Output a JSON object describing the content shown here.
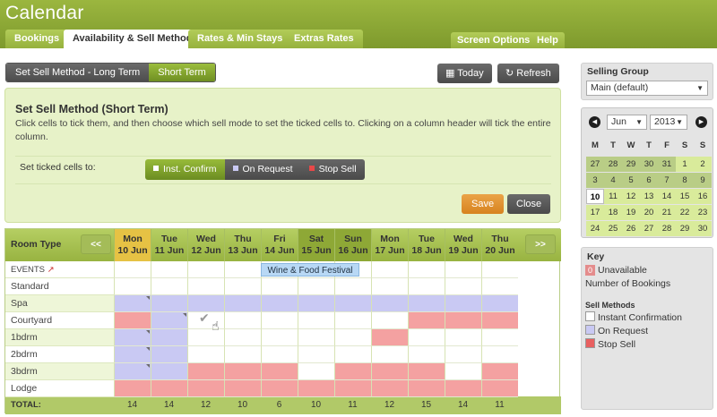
{
  "app": {
    "title": "Calendar"
  },
  "tabs": [
    {
      "label": "Bookings",
      "active": false
    },
    {
      "label": "Availability & Sell Method",
      "active": true
    },
    {
      "label": "Rates & Min Stays",
      "active": false
    },
    {
      "label": "Extras Rates",
      "active": false
    }
  ],
  "header_buttons": {
    "screen_options": "Screen Options",
    "help": "Help"
  },
  "segment": {
    "long_term": "Set Sell Method - Long Term",
    "short_term": "Short Term"
  },
  "toolbar": {
    "today": "Today",
    "refresh": "Refresh"
  },
  "panel": {
    "title": "Set Sell Method (Short Term)",
    "description": "Click cells to tick them, and then choose which sell mode to set the ticked cells to. Clicking on a column header will tick the entire column.",
    "set_label": "Set ticked cells to:",
    "modes": {
      "instant": "Inst. Confirm",
      "on_request": "On Request",
      "stop_sell": "Stop Sell"
    },
    "save": "Save",
    "close": "Close"
  },
  "grid": {
    "room_type_label": "Room Type",
    "prev": "<<",
    "next": ">>",
    "days": [
      {
        "dow": "Mon",
        "date": "10 Jun",
        "kind": "today"
      },
      {
        "dow": "Tue",
        "date": "11 Jun",
        "kind": ""
      },
      {
        "dow": "Wed",
        "date": "12 Jun",
        "kind": ""
      },
      {
        "dow": "Thu",
        "date": "13 Jun",
        "kind": ""
      },
      {
        "dow": "Fri",
        "date": "14 Jun",
        "kind": ""
      },
      {
        "dow": "Sat",
        "date": "15 Jun",
        "kind": "wkend"
      },
      {
        "dow": "Sun",
        "date": "16 Jun",
        "kind": "wkend"
      },
      {
        "dow": "Mon",
        "date": "17 Jun",
        "kind": ""
      },
      {
        "dow": "Tue",
        "date": "18 Jun",
        "kind": ""
      },
      {
        "dow": "Wed",
        "date": "19 Jun",
        "kind": ""
      },
      {
        "dow": "Thu",
        "date": "20 Jun",
        "kind": ""
      }
    ],
    "events_label": "EVENTS",
    "event_name": "Wine & Food Festival",
    "rooms": [
      {
        "name": "Standard",
        "cells": [
          "w",
          "w",
          "w",
          "w",
          "w",
          "w",
          "w",
          "w",
          "w",
          "w",
          "w"
        ]
      },
      {
        "name": "Spa",
        "cells": [
          "p",
          "p",
          "p",
          "p",
          "p",
          "p",
          "p",
          "p",
          "p",
          "p",
          "p"
        ]
      },
      {
        "name": "Courtyard",
        "cells": [
          "r",
          "p",
          "w",
          "w",
          "w",
          "w",
          "w",
          "w",
          "r",
          "r",
          "r"
        ]
      },
      {
        "name": "1bdrm",
        "cells": [
          "p",
          "p",
          "w",
          "w",
          "w",
          "w",
          "w",
          "r",
          "w",
          "w",
          "w"
        ]
      },
      {
        "name": "2bdrm",
        "cells": [
          "p",
          "p",
          "w",
          "w",
          "w",
          "w",
          "w",
          "w",
          "w",
          "w",
          "w"
        ]
      },
      {
        "name": "3bdrm",
        "cells": [
          "p",
          "p",
          "r",
          "r",
          "r",
          "w",
          "r",
          "r",
          "r",
          "w",
          "r"
        ]
      },
      {
        "name": "Lodge",
        "cells": [
          "r",
          "r",
          "r",
          "r",
          "r",
          "r",
          "r",
          "r",
          "r",
          "r",
          "r"
        ]
      }
    ],
    "totals_label": "TOTAL:",
    "totals": [
      "14",
      "14",
      "12",
      "10",
      "6",
      "10",
      "11",
      "12",
      "15",
      "14",
      "11"
    ]
  },
  "sidebar": {
    "selling_group_label": "Selling Group",
    "selling_group_value": "Main (default)",
    "calendar": {
      "month": "Jun",
      "year": "2013",
      "dow": [
        "M",
        "T",
        "W",
        "T",
        "F",
        "S",
        "S"
      ],
      "weeks": [
        [
          [
            "27",
            "p"
          ],
          [
            "28",
            "p"
          ],
          [
            "29",
            "p"
          ],
          [
            "30",
            "p"
          ],
          [
            "31",
            "p"
          ],
          [
            "1",
            "f"
          ],
          [
            "2",
            "f"
          ]
        ],
        [
          [
            "3",
            "p"
          ],
          [
            "4",
            "p"
          ],
          [
            "5",
            "p"
          ],
          [
            "6",
            "p"
          ],
          [
            "7",
            "p"
          ],
          [
            "8",
            "p"
          ],
          [
            "9",
            "p"
          ]
        ],
        [
          [
            "10",
            "t"
          ],
          [
            "11",
            "f"
          ],
          [
            "12",
            "f"
          ],
          [
            "13",
            "f"
          ],
          [
            "14",
            "f"
          ],
          [
            "15",
            "f"
          ],
          [
            "16",
            "f"
          ]
        ],
        [
          [
            "17",
            "f"
          ],
          [
            "18",
            "f"
          ],
          [
            "19",
            "f"
          ],
          [
            "20",
            "f"
          ],
          [
            "21",
            "f"
          ],
          [
            "22",
            "f"
          ],
          [
            "23",
            "f"
          ]
        ],
        [
          [
            "24",
            "f"
          ],
          [
            "25",
            "f"
          ],
          [
            "26",
            "f"
          ],
          [
            "27",
            "f"
          ],
          [
            "28",
            "f"
          ],
          [
            "29",
            "f"
          ],
          [
            "30",
            "f"
          ]
        ]
      ]
    },
    "key": {
      "title": "Key",
      "unavailable_badge": "0",
      "unavailable": "Unavailable",
      "bookings": "Number of Bookings",
      "sell_methods": "Sell Methods",
      "instant": "Instant Confirmation",
      "on_request": "On Request",
      "stop_sell": "Stop Sell"
    }
  },
  "colors": {
    "brand_green": "#8aa735",
    "on_request": "#c9c9f3",
    "stop_sell": "#f4a1a1",
    "today": "#e6c244",
    "save": "#e0922f"
  }
}
